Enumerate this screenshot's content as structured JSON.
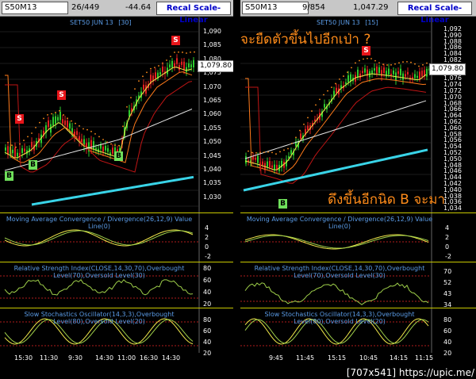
{
  "left": {
    "symbol": "S50M13",
    "counter": "26/449",
    "change": "-44.64",
    "recal": "Recal Scale-Linear",
    "title": "SET50 JUN 13",
    "interval": "[30]",
    "price_box": "1,079.80",
    "y_labels": [
      "1,090",
      "1,085",
      "1,080",
      "1,075",
      "1,070",
      "1,065",
      "1,060",
      "1,055",
      "1,050",
      "1,045",
      "1,040",
      "1,035",
      "1,030"
    ],
    "macd_title": "Moving Average Convergence / Divergence(26,12,9) Value",
    "macd_title2": "Line(0)",
    "macd_labels": [
      "4",
      "2",
      "0",
      "-2"
    ],
    "rsi_title": "Relative Strength Index(CLOSE,14,30,70),Overbought",
    "rsi_title2": "Level(70),Oversold Level(30)",
    "rsi_labels": [
      "80",
      "60",
      "40",
      "20"
    ],
    "sto_title": "Slow Stochastics Oscillator(14,3,3),Overbought",
    "sto_title2": "Level(80),Oversold Level(20)",
    "sto_labels": [
      "80",
      "60",
      "40",
      "20"
    ],
    "x_labels": [
      "15:30",
      "11:30",
      "9:30",
      "14:30",
      "11:00",
      "16:30",
      "14:30"
    ],
    "signals": [
      "S",
      "S",
      "S",
      "B",
      "B",
      "B"
    ]
  },
  "right": {
    "symbol": "S50M13",
    "counter": "9/854",
    "change": "1,047.29",
    "recal": "Recal Scale-Linear",
    "title": "SET50 JUN 13",
    "interval": "[15]",
    "price_box": "1,079.80",
    "y_labels": [
      "1,092",
      "1,090",
      "1,088",
      "1,086",
      "1,084",
      "1,082",
      "1,080",
      "1,078",
      "1,076",
      "1,074",
      "1,072",
      "1,070",
      "1,068",
      "1,066",
      "1,064",
      "1,062",
      "1,060",
      "1,058",
      "1,056",
      "1,054",
      "1,052",
      "1,050",
      "1,048",
      "1,046",
      "1,044",
      "1,042",
      "1,040",
      "1,038",
      "1,036",
      "1,034"
    ],
    "macd_title": "Moving Average Convergence / Divergence(26,12,9) Value",
    "macd_title2": "Line(0)",
    "macd_labels": [
      "4",
      "2",
      "0",
      "-2"
    ],
    "rsi_title": "Relative Strength Index(CLOSE,14,30,70),Overbought",
    "rsi_title2": "Level(70),Oversold Level(30)",
    "rsi_labels": [
      "70",
      "52",
      "43",
      "34"
    ],
    "sto_title": "Slow Stochastics Oscillator(14,3,3),Overbought",
    "sto_title2": "Level(80),Oversold Level(20)",
    "sto_labels": [
      "80",
      "60",
      "40",
      "20"
    ],
    "x_labels": [
      "9:45",
      "11:45",
      "15:15",
      "10:45",
      "14:15",
      "11:15"
    ],
    "signals": [
      "S",
      "B"
    ],
    "annot_top": "จะยืดตัวขึ้นไปอีกเป่า ?",
    "annot_bottom": "ดึงขึ้นอีกนิด B จะมา"
  },
  "footer": "[707x541] https://upic.me/",
  "colors": {
    "toolbar": "#c7c7c7",
    "title": "#5a9be6",
    "up_candle": "#2ecc2e",
    "down_candle": "#e02020",
    "annotation": "#ff8c1a",
    "signal_sell": "#e8151a",
    "signal_buy": "#6fe05b"
  }
}
